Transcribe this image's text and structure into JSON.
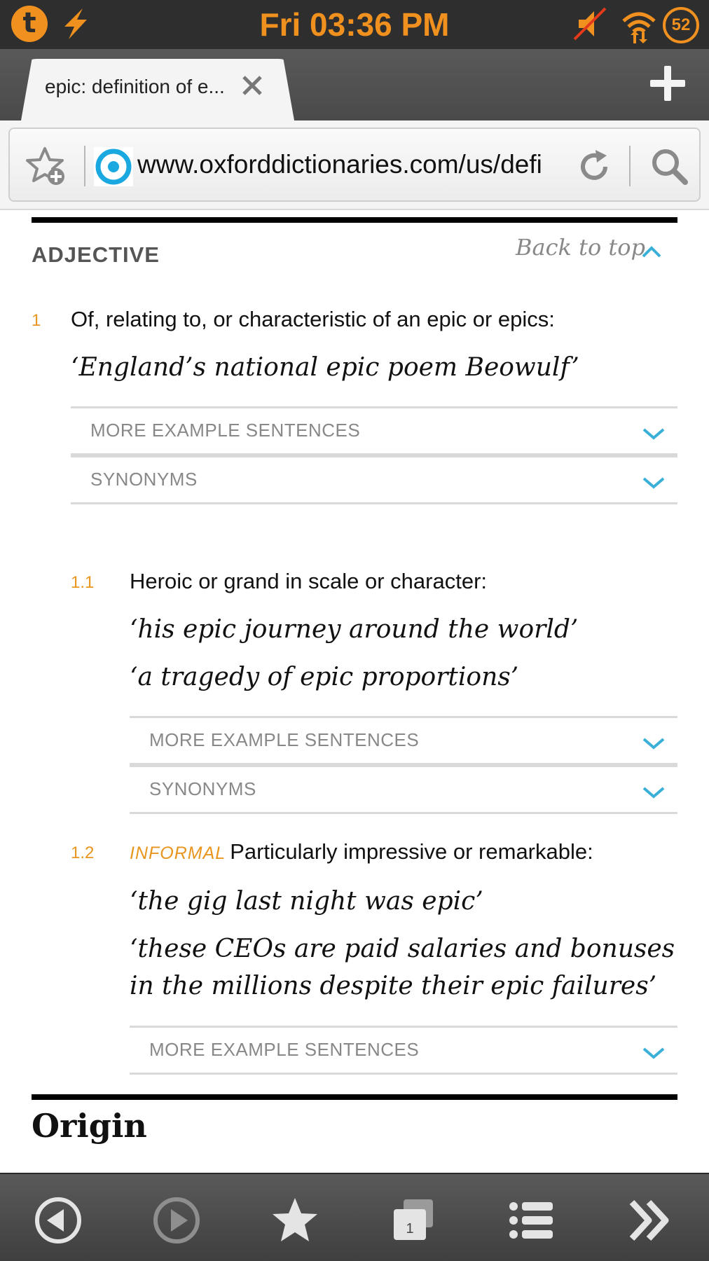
{
  "status_bar": {
    "time": "Fri 03:36 PM",
    "battery": "52",
    "accent_color": "#f0901f",
    "icons": [
      "talk-icon",
      "bolt-icon",
      "mute-icon",
      "wifi-icon",
      "battery-icon"
    ]
  },
  "tab": {
    "title": "epic: definition of e..."
  },
  "url_bar": {
    "url": "www.oxforddictionaries.com/us/defi"
  },
  "entry": {
    "part_of_speech": "ADJECTIVE",
    "back_to_top": "Back to top",
    "senses": [
      {
        "number": "1",
        "definition": "Of, relating to, or characteristic of an epic or epics:",
        "examples": [
          "‘England’s national epic poem Beowulf’"
        ],
        "more_examples_label": "MORE EXAMPLE SENTENCES",
        "synonyms_label": "SYNONYMS"
      },
      {
        "number": "1.1",
        "definition": "Heroic or grand in scale or character:",
        "examples": [
          "‘his epic journey around the world’",
          "‘a tragedy of epic proportions’"
        ],
        "more_examples_label": "MORE EXAMPLE SENTENCES",
        "synonyms_label": "SYNONYMS"
      },
      {
        "number": "1.2",
        "register": "INFORMAL",
        "definition": "Particularly impressive or remarkable:",
        "examples": [
          "‘the gig last night was epic’",
          "‘these CEOs are paid salaries and bonuses in the millions despite their epic failures’"
        ],
        "more_examples_label": "MORE EXAMPLE SENTENCES"
      }
    ],
    "next_section": "Origin"
  },
  "colors": {
    "sense_number": "#e8961e",
    "chevron": "#3ab0d8",
    "rule": "#000000"
  }
}
